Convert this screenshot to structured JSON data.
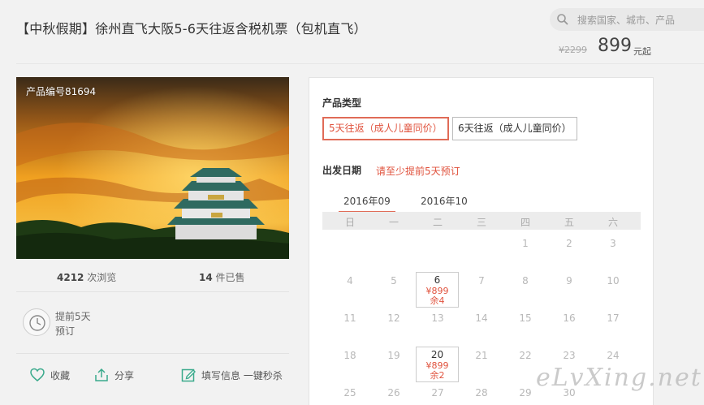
{
  "header": {
    "title": "【中秋假期】徐州直飞大阪5-6天往返含税机票（包机直飞）",
    "search_placeholder": "搜索国家、城市、产品",
    "price_old": "¥2299",
    "price_now": "899",
    "price_unit": "元起"
  },
  "product": {
    "code_label": "产品编号81694",
    "views_count": "4212",
    "views_label": "次浏览",
    "sold_count": "14",
    "sold_label": "件已售",
    "advance_line1": "提前5天",
    "advance_line2": "预订",
    "actions": {
      "favorite": "收藏",
      "share": "分享",
      "fill_info": "填写信息 一键秒杀"
    }
  },
  "booking": {
    "type_label": "产品类型",
    "types": [
      "5天往返（成人儿童同价）",
      "6天往返（成人儿童同价）"
    ],
    "date_label": "出发日期",
    "date_note": "请至少提前5天预订",
    "months": [
      "2016年09",
      "2016年10"
    ],
    "weekdays": [
      "日",
      "一",
      "二",
      "三",
      "四",
      "五",
      "六"
    ],
    "rows": [
      [
        "",
        "",
        "",
        "",
        "1",
        "2",
        "3"
      ],
      [
        "4",
        "5",
        "6",
        "7",
        "8",
        "9",
        "10"
      ],
      [
        "11",
        "12",
        "13",
        "14",
        "15",
        "16",
        "17"
      ],
      [
        "18",
        "19",
        "20",
        "21",
        "22",
        "23",
        "24"
      ],
      [
        "25",
        "26",
        "27",
        "28",
        "29",
        "30",
        ""
      ]
    ],
    "available": [
      {
        "day": "6",
        "price": "¥899",
        "remain": "余4"
      },
      {
        "day": "20",
        "price": "¥899",
        "remain": "余2"
      }
    ]
  },
  "watermark": "eLvXing.net",
  "colors": {
    "accent": "#e0533e",
    "icon_green": "#3aaa8c"
  }
}
